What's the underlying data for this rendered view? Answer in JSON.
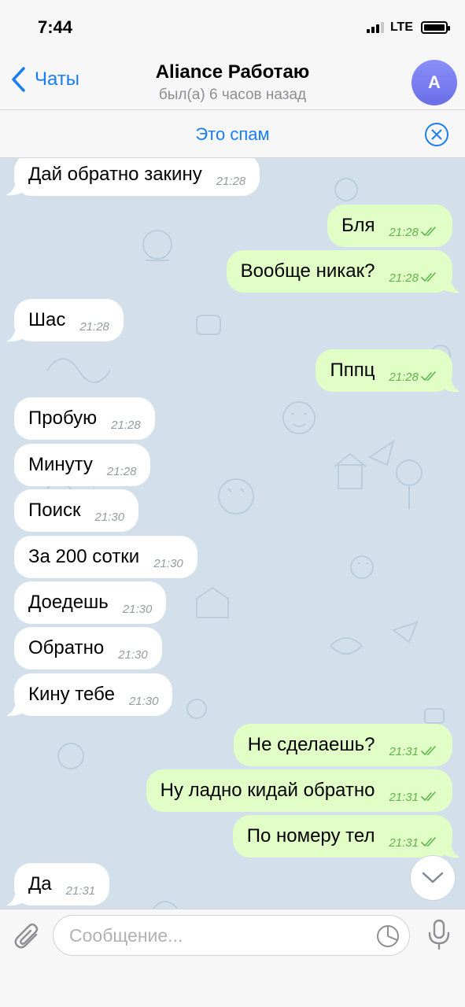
{
  "status_bar": {
    "time": "7:44",
    "network": "LTE"
  },
  "nav": {
    "back_label": "Чаты",
    "title": "Aliance Работаю",
    "subtitle": "был(а) 6 часов назад",
    "avatar_letter": "A"
  },
  "spam_bar": {
    "label": "Это спам"
  },
  "messages": [
    {
      "dir": "in",
      "text": "Дай обратно закину",
      "time": "21:28"
    },
    {
      "dir": "out",
      "text": "Бля",
      "time": "21:28"
    },
    {
      "dir": "out",
      "text": "Вообще никак?",
      "time": "21:28"
    },
    {
      "dir": "in",
      "text": "Шас",
      "time": "21:28"
    },
    {
      "dir": "out",
      "text": "Пппц",
      "time": "21:28"
    },
    {
      "dir": "in",
      "text": "Пробую",
      "time": "21:28"
    },
    {
      "dir": "in",
      "text": "Минуту",
      "time": "21:28"
    },
    {
      "dir": "in",
      "text": "Поиск",
      "time": "21:30"
    },
    {
      "dir": "in",
      "text": "За 200 сотки",
      "time": "21:30"
    },
    {
      "dir": "in",
      "text": "Доедешь",
      "time": "21:30"
    },
    {
      "dir": "in",
      "text": "Обратно",
      "time": "21:30"
    },
    {
      "dir": "in",
      "text": "Кину тебе",
      "time": "21:30"
    },
    {
      "dir": "out",
      "text": "Не сделаешь?",
      "time": "21:31"
    },
    {
      "dir": "out",
      "text": "Ну ладно кидай обратно",
      "time": "21:31"
    },
    {
      "dir": "out",
      "text": "По номеру тел",
      "time": "21:31"
    },
    {
      "dir": "in",
      "text": "Да",
      "time": "21:31"
    }
  ],
  "composer": {
    "placeholder": "Сообщение..."
  },
  "colors": {
    "accent": "#1a7ef2",
    "incoming_bubble": "#ffffff",
    "outgoing_bubble": "#e1fec6",
    "chat_background": "#d3e0ec",
    "read_ticks": "#5fb54d"
  },
  "icons": {
    "back": "chevron-left-icon",
    "avatar": "avatar",
    "spam_close": "close-circle-icon",
    "scroll_down": "chevron-down-icon",
    "attach": "paperclip-icon",
    "sticker": "sticker-icon",
    "mic": "microphone-icon",
    "read_status": "double-check-icon"
  }
}
